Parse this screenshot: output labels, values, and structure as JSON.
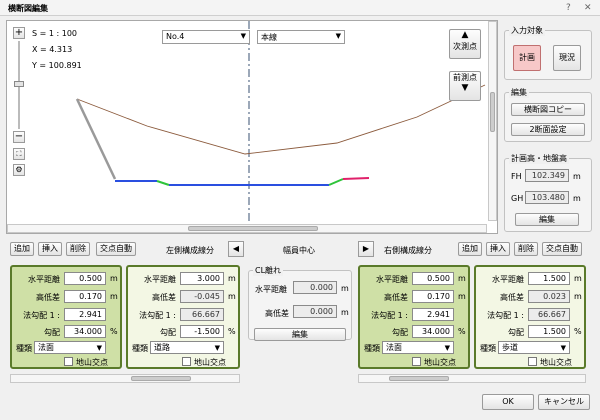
{
  "window": {
    "title": "横断図編集",
    "help": "?",
    "close": "✕"
  },
  "view": {
    "scale": "S = 1 : 100",
    "x": "X = 4.313",
    "y": "Y = 100.891",
    "station_select": "No.4",
    "line_select": "本線",
    "next_point": "次測点",
    "prev_point": "前測点"
  },
  "side": {
    "input_target": "入力対象",
    "plan": "計画",
    "existing": "現況",
    "edit": "編集",
    "copy": "横断図コピー",
    "two_section": "2断面設定",
    "plan_height": "計画高・地盤高",
    "fh_label": "FH",
    "fh_value": "102.349",
    "gh_label": "GH",
    "gh_value": "103.480",
    "unit": "m",
    "edit_btn": "編集"
  },
  "toolbar": {
    "add": "追加",
    "insert": "挿入",
    "delete": "削除",
    "auto": "交点自動",
    "left_title": "左側構成線分",
    "center": "幅員中心",
    "right_title": "右側構成線分",
    "left_arrow": "◀",
    "right_arrow": "▶"
  },
  "labels": {
    "horiz": "水平距離",
    "height": "高低差",
    "slope": "法勾配  1 :",
    "grade": "勾配",
    "kind": "種類",
    "ground": "地山交点",
    "m": "m",
    "pct": "%"
  },
  "panels": [
    {
      "horiz": "0.500",
      "height": "0.170",
      "slope": "2.941",
      "grade": "34.000",
      "kind": "法面"
    },
    {
      "horiz": "3.000",
      "height": "-0.045",
      "slope": "66.667",
      "grade": "-1.500",
      "kind": "道路"
    },
    {
      "horiz": "0.500",
      "height": "0.170",
      "slope": "2.941",
      "grade": "34.000",
      "kind": "法面"
    },
    {
      "horiz": "1.500",
      "height": "0.023",
      "slope": "66.667",
      "grade": "1.500",
      "kind": "歩道"
    }
  ],
  "cl": {
    "title": "CL離れ",
    "horiz": "水平距離",
    "horiz_value": "0.000",
    "height": "高低差",
    "height_value": "0.000",
    "edit": "編集"
  },
  "footer": {
    "ok": "OK",
    "cancel": "キャンセル"
  },
  "colors": {
    "panel_border": "#5a7a2a",
    "panel_bg": "#cfe0a6",
    "panel_light": "#f3f7e4",
    "ground_line": "#8b5a3c",
    "blue_line": "#2a4fe0",
    "green_line": "#2ec43a",
    "pink_line": "#e0206a",
    "cyan_line": "#2aa6d6",
    "plan_btn": "#f7c8c8"
  }
}
